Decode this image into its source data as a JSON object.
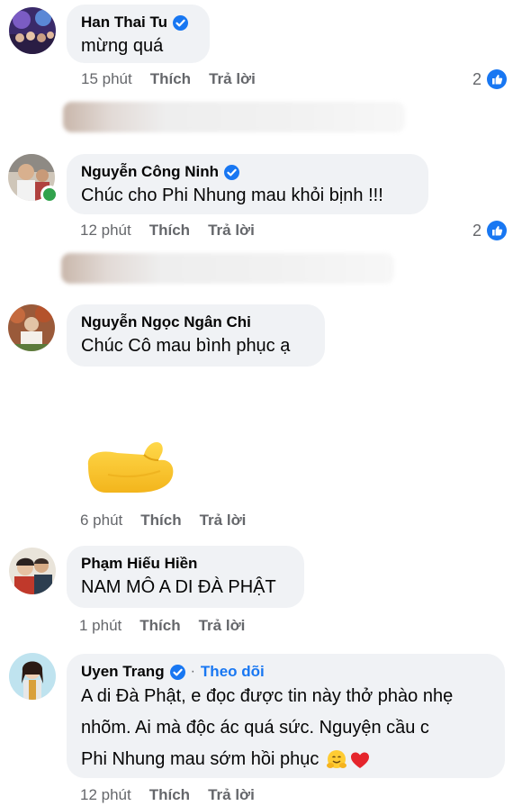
{
  "comments": [
    {
      "name": "Han Thai Tu",
      "verified": true,
      "text": "mừng quá",
      "time": "15 phút",
      "like_label": "Thích",
      "reply_label": "Trả lời",
      "reaction_count": "2"
    },
    {
      "name": "Nguyễn Công Ninh",
      "verified": true,
      "online": true,
      "text": "Chúc cho Phi Nhung mau khỏi bịnh !!!",
      "time": "12 phút",
      "like_label": "Thích",
      "reply_label": "Trả lời",
      "reaction_count": "2"
    },
    {
      "name": "Nguyễn Ngọc Ngân Chi",
      "verified": false,
      "text": "Chúc Cô mau bình phục ạ",
      "sticker": "hand-sticker-icon",
      "time": "6 phút",
      "like_label": "Thích",
      "reply_label": "Trả lời"
    },
    {
      "name": "Phạm Hiếu Hiền",
      "verified": false,
      "text": "NAM MÔ A DI ĐÀ PHẬT",
      "time": "1 phút",
      "like_label": "Thích",
      "reply_label": "Trả lời"
    },
    {
      "name": "Uyen Trang",
      "verified": true,
      "follow_label": "Theo dõi",
      "separator": "·",
      "text_lines": [
        "A di Đà Phật, e đọc được tin này thở phào nhẹ",
        "nhõm. Ai mà độc ác quá sức. Nguyện cầu c",
        "Phi Nhung mau sớm hồi phục"
      ],
      "emojis": [
        "hugging-face-icon",
        "red-heart-icon"
      ],
      "time": "12 phút",
      "like_label": "Thích",
      "reply_label": "Trả lời"
    }
  ],
  "colors": {
    "bubble": "#f0f2f5",
    "accent": "#1877f2",
    "secondary_text": "#65676b",
    "online": "#31a24c"
  }
}
